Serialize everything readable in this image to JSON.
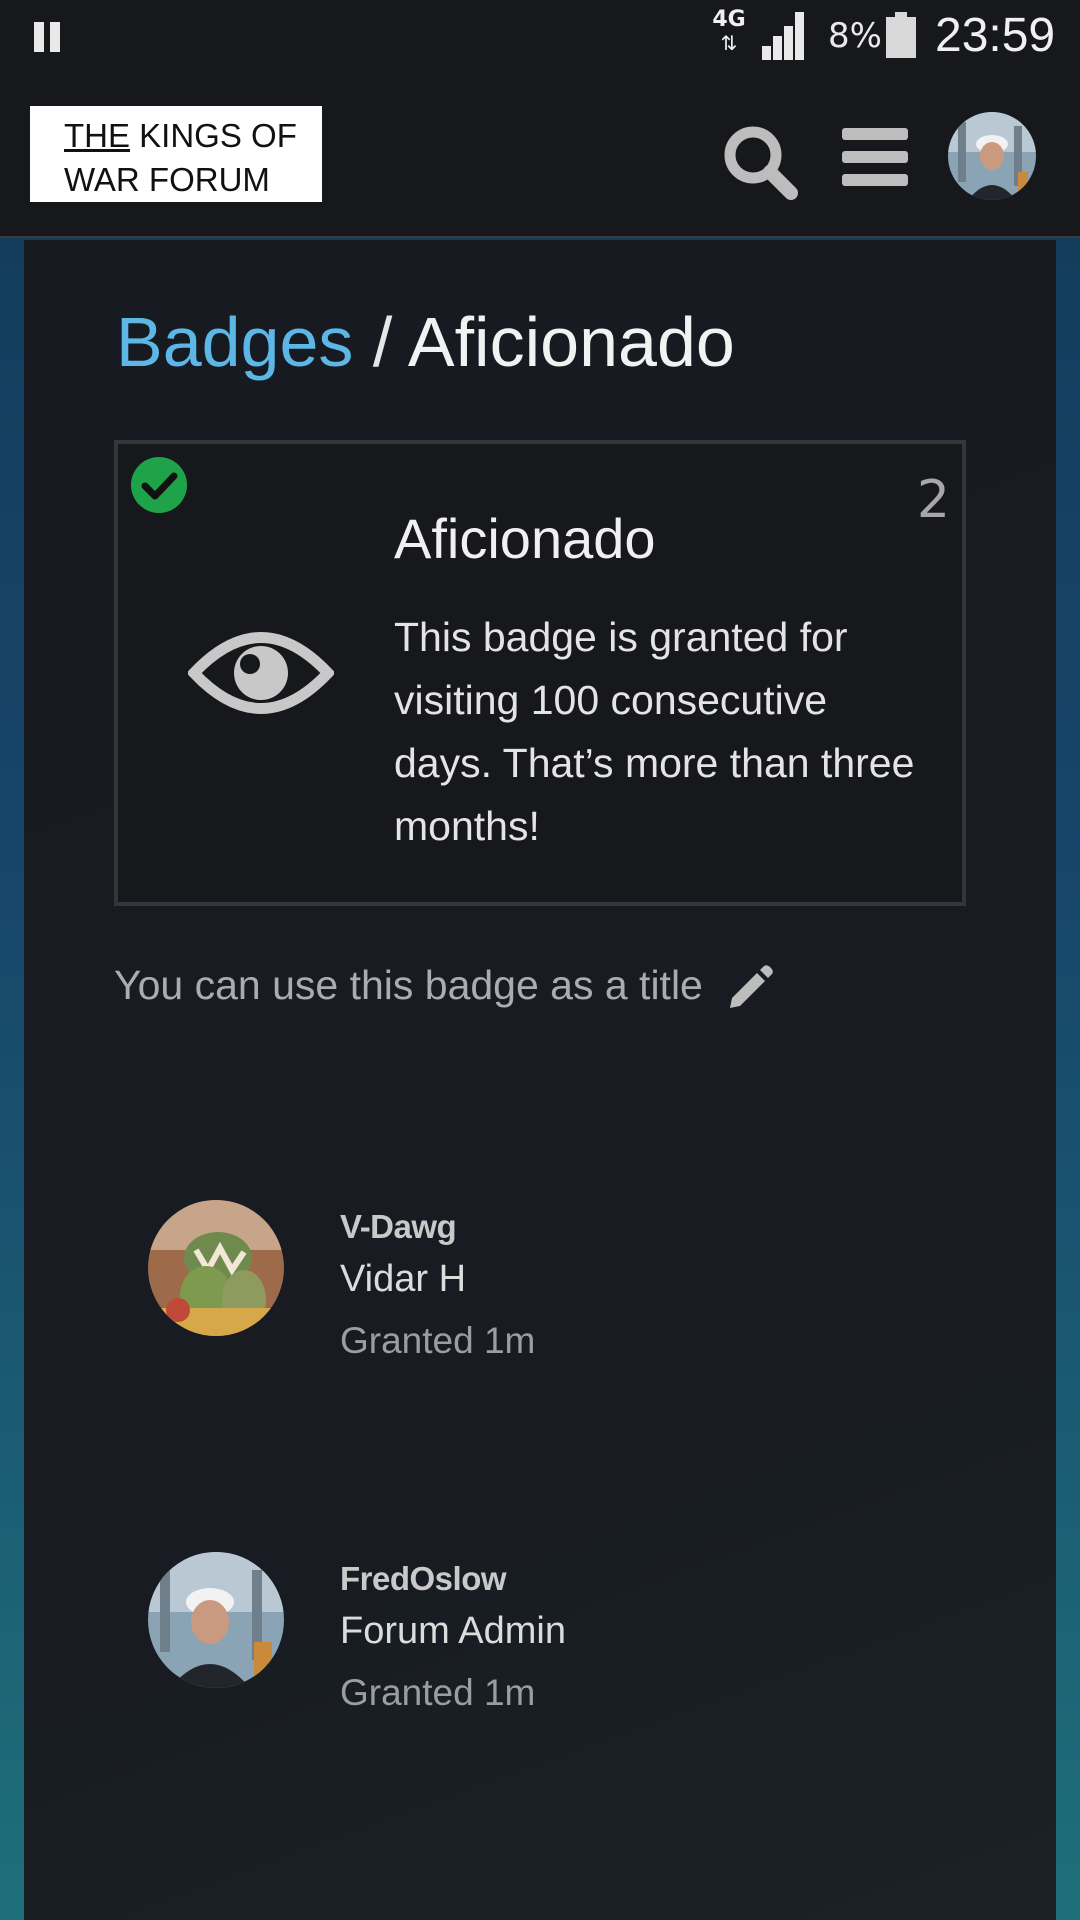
{
  "status_bar": {
    "network": "4G",
    "network_arrows": "⇅",
    "battery": "8%",
    "time": "23:59"
  },
  "header": {
    "logo_line1_underlined": "THE",
    "logo_line1_rest": " KINGS OF",
    "logo_line2": "WAR FORUM",
    "icons": [
      "search-icon",
      "menu-icon",
      "avatar"
    ]
  },
  "breadcrumb": {
    "parent": "Badges",
    "separator": " / ",
    "current": "Aficionado"
  },
  "badge": {
    "name": "Aficionado",
    "count": "2",
    "description": "This badge is granted for visiting 100 consecutive days. That’s more than three months!",
    "icon": "eye-icon",
    "granted_icon": "check-circle-icon"
  },
  "title_note": "You can use this badge as a title",
  "grantees": [
    {
      "username": "V-Dawg",
      "name": "Vidar H",
      "granted": "Granted 1m"
    },
    {
      "username": "FredOslow",
      "name": "Forum Admin",
      "granted": "Granted 1m"
    }
  ],
  "colors": {
    "link": "#5db7e6",
    "check": "#1fa34a",
    "card_border": "#34363a"
  }
}
